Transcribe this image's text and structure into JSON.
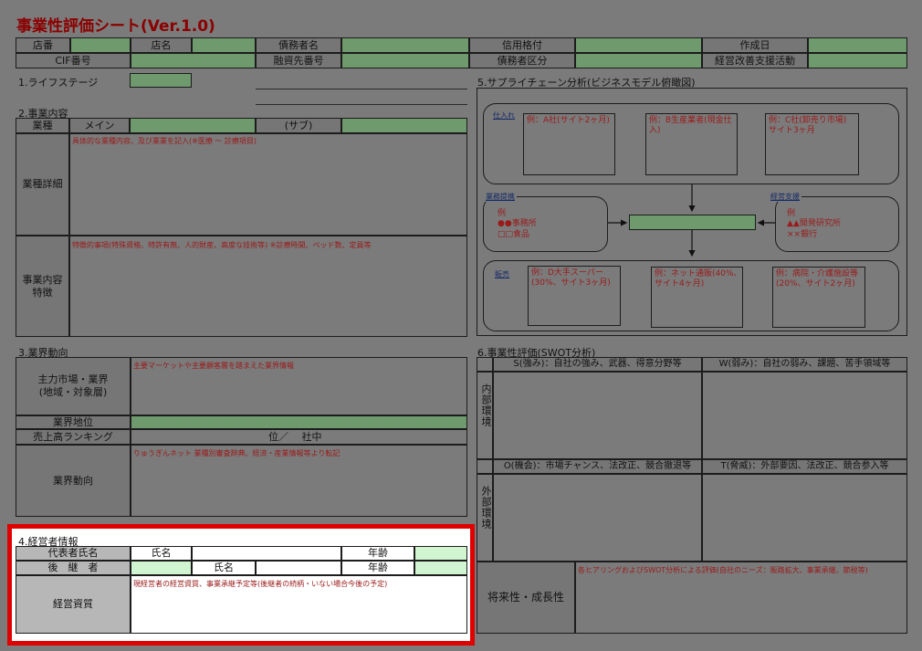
{
  "title": "事業性評価シート(Ver.1.0)",
  "header": {
    "row1": [
      "店番",
      "店名",
      "債務者名",
      "信用格付",
      "作成日"
    ],
    "row2": [
      "CIF番号",
      "融資先番号",
      "債務者区分",
      "経営改善支援活動"
    ]
  },
  "s1": {
    "title": "1.ライフステージ"
  },
  "s2": {
    "title": "2.事業内容",
    "gyoshu": "業種",
    "main": "メイン",
    "sub": "(サブ)",
    "detail_label": "業種詳細",
    "detail_note": "具体的な業種内容、及び業業を記入(※医療 ～ 診療項目)",
    "feature_label": "事業内容\n特徴",
    "feature_note": "特徴的事項(特殊資格、特許有無、人的財産、高度な技術等) ※診療時間、ベッド数、定員等"
  },
  "s3": {
    "title": "3.業界動向",
    "market_label": "主力市場・業界\n(地域・対象層)",
    "market_note": "主要マーケットや主要顧客層を踏まえた業界情報",
    "position_label": "業界地位",
    "ranking_label": "売上高ランキング",
    "ranking_value": "位／　 社中",
    "trend_label": "業界動向",
    "trend_note": "りゅうぎんネット 業種別審査辞典、経済・産業情報等より転記"
  },
  "s4": {
    "title": "4.経営者情報",
    "rep_label": "代表者氏名",
    "name": "氏名",
    "age": "年齢",
    "successor_label": "後　継　者",
    "quality_label": "経営資質",
    "quality_note": "現経営者の経営資質、事業承継予定等(後継者の続柄・いない場合今後の予定)"
  },
  "s5": {
    "title": "5.サプライチェーン分析(ビジネスモデル俯瞰図)",
    "supply_label": "仕入れ",
    "supply_boxes": [
      "例：A社(サイト2ヶ月)",
      "例：B生産業者(現金仕入)",
      "例：C社(卸売り市場)\nサイト3ヶ月"
    ],
    "partner_label": "業務提携",
    "partner_text": "例\n●●事務所\n□□食品",
    "support_label": "経営支援",
    "support_text": "例\n▲▲開発研究所\n××銀行",
    "sales_label": "販売",
    "sales_boxes": [
      "例：D大手スーパー\n(30%、サイト3ヶ月)",
      "例：ネット通販(40%、\nサイト4ヶ月)",
      "例：病院・介護施設等\n(20%、サイト2ヶ月)"
    ]
  },
  "s6": {
    "title": "6.事業性評価(SWOT分析)",
    "s_label": "S(強み)：自社の強み、武器、得意分野等",
    "w_label": "W(弱み)：自社の弱み、課題、苦手領域等",
    "o_label": "O(機会)：市場チャンス、法改正、競合撤退等",
    "t_label": "T(脅威)：外部要因、法改正、競合参入等",
    "internal": "内部環境",
    "external": "外部環境",
    "future_label": "将来性・成長性",
    "future_note": "各ヒアリングおよびSWOT分析による評価(自社のニーズ：販路拡大、事業承継、節税等)"
  },
  "colors": {
    "highlight": "#e00000",
    "title": "#8b0000",
    "green": "#6e9a6e"
  }
}
